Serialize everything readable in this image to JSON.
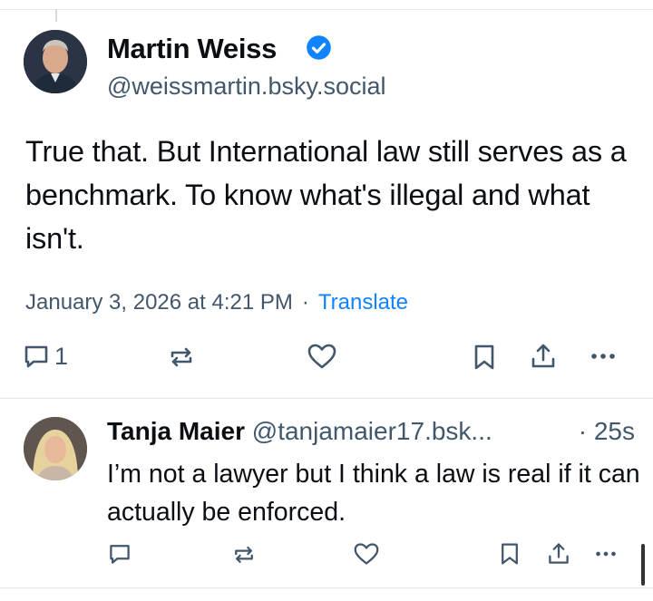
{
  "post": {
    "author_name": "Martin Weiss",
    "handle": "@weissmartin.bsky.social",
    "verified": true,
    "text": "True that. But International law still serves as a benchmark. To know what's illegal and what isn't.",
    "timestamp": "January 3, 2026 at 4:21 PM",
    "separator": "·",
    "translate_label": "Translate",
    "actions": {
      "reply_count": "1",
      "reply_icon": "speech-bubble-icon",
      "repost_icon": "repost-icon",
      "like_icon": "heart-icon",
      "bookmark_icon": "bookmark-icon",
      "share_icon": "share-icon",
      "more_icon": "more-icon"
    }
  },
  "reply": {
    "author_name": "Tanja Maier",
    "handle": "@tanjamaier17.bsk...",
    "time": "· 25s",
    "text": "I’m not a lawyer but I think a law is real if it can actually be enforced."
  },
  "colors": {
    "text": "#0b0f14",
    "muted": "#42576c",
    "link": "#1083fe",
    "verified": "#1083fe",
    "divider": "#e3e7eb"
  }
}
